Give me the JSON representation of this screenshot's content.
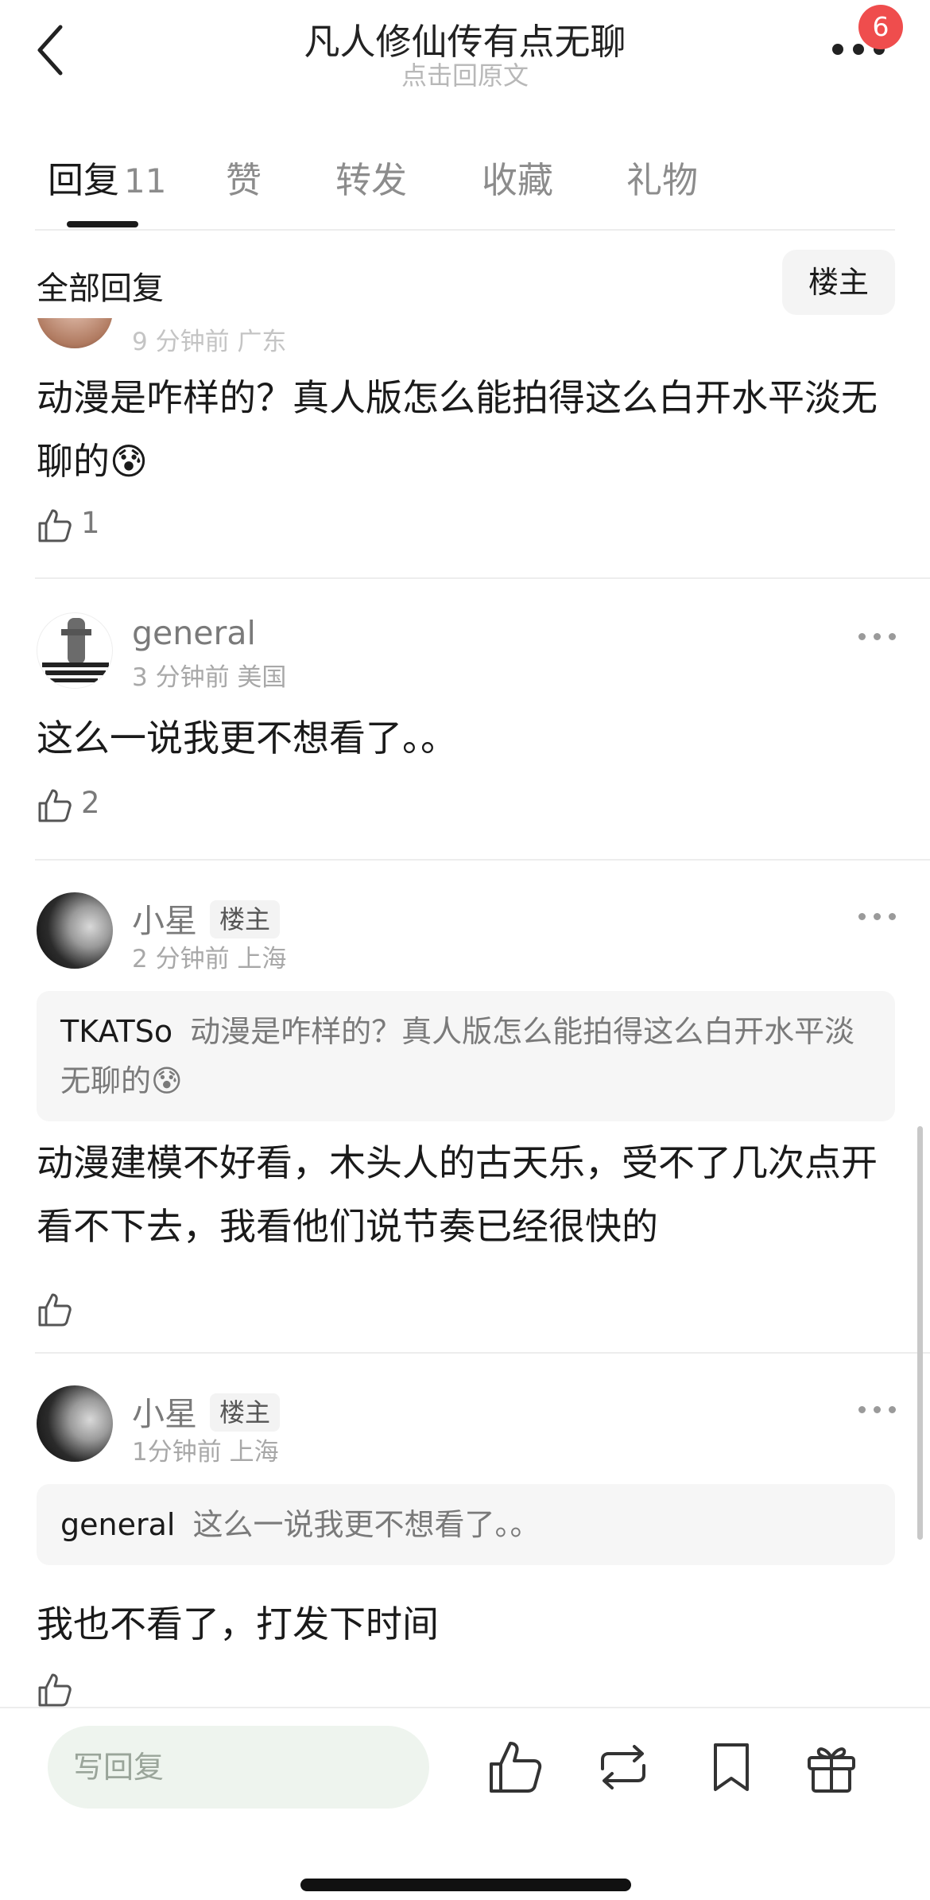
{
  "header": {
    "title": "凡人修仙传有点无聊",
    "subtitle": "点击回原文",
    "notification_count": "6"
  },
  "tabs": [
    {
      "label": "回复",
      "count": "11"
    },
    {
      "label": "赞"
    },
    {
      "label": "转发"
    },
    {
      "label": "收藏"
    },
    {
      "label": "礼物"
    }
  ],
  "sort": {
    "all_label": "全部回复",
    "op_filter_label": "楼主"
  },
  "comments": [
    {
      "meta": "9 分钟前 广东",
      "text": "动漫是咋样的？真人版怎么能拍得这么白开水平淡无聊的😰",
      "likes": "1"
    },
    {
      "username": "general",
      "meta": "3 分钟前 美国",
      "text": "这么一说我更不想看了。。",
      "likes": "2"
    },
    {
      "username": "小星",
      "tag": "楼主",
      "meta": "2 分钟前 上海",
      "quote_name": "TKATSo",
      "quote_text": "动漫是咋样的？真人版怎么能拍得这么白开水平淡无聊的😰",
      "text": "动漫建模不好看，木头人的古天乐，受不了几次点开看不下去，我看他们说节奏已经很快的"
    },
    {
      "username": "小星",
      "tag": "楼主",
      "meta": "1分钟前 上海",
      "quote_name": "general",
      "quote_text": "这么一说我更不想看了。。",
      "text": "我也不看了，打发下时间"
    }
  ],
  "bottom": {
    "reply_placeholder": "写回复"
  },
  "colors": {
    "badge": "#ef4d4d",
    "text_primary": "#1a1a1a",
    "text_secondary": "#7a7a7a",
    "input_bg": "#eef4ee"
  }
}
